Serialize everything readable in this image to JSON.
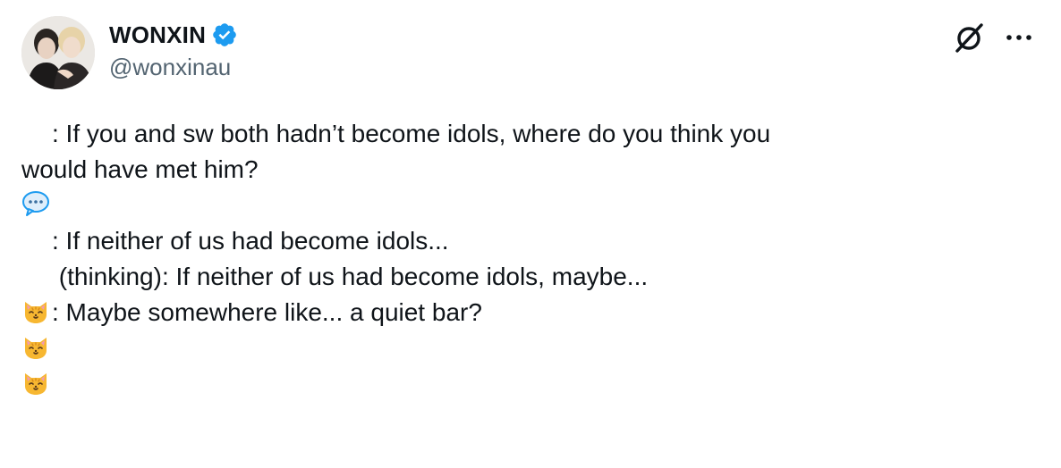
{
  "author": {
    "display_name": "WONXIN",
    "handle": "@wonxinau",
    "verified": true,
    "verified_color": "#1d9bf0"
  },
  "top_actions": {
    "grok_icon": "grok-slash-icon",
    "more_icon": "more-dots-icon",
    "more_label": "···"
  },
  "tweet": {
    "q_prefix": ": If you and sw both hadn’t become idols, where do you think you",
    "q_cont": "would have met him?",
    "a1": ": If neither of us had become idols...",
    "a2": " (thinking): If neither of us had become idols, maybe...",
    "a3": ": Maybe somewhere like... a quiet bar?",
    "question_icon": "speech-bubble-icon",
    "answer_icon": "cat-face-icon"
  },
  "colors": {
    "text": "#0f1419",
    "secondary": "#536471",
    "bubble": "#1d9bf0",
    "cat": "#f7b731"
  }
}
